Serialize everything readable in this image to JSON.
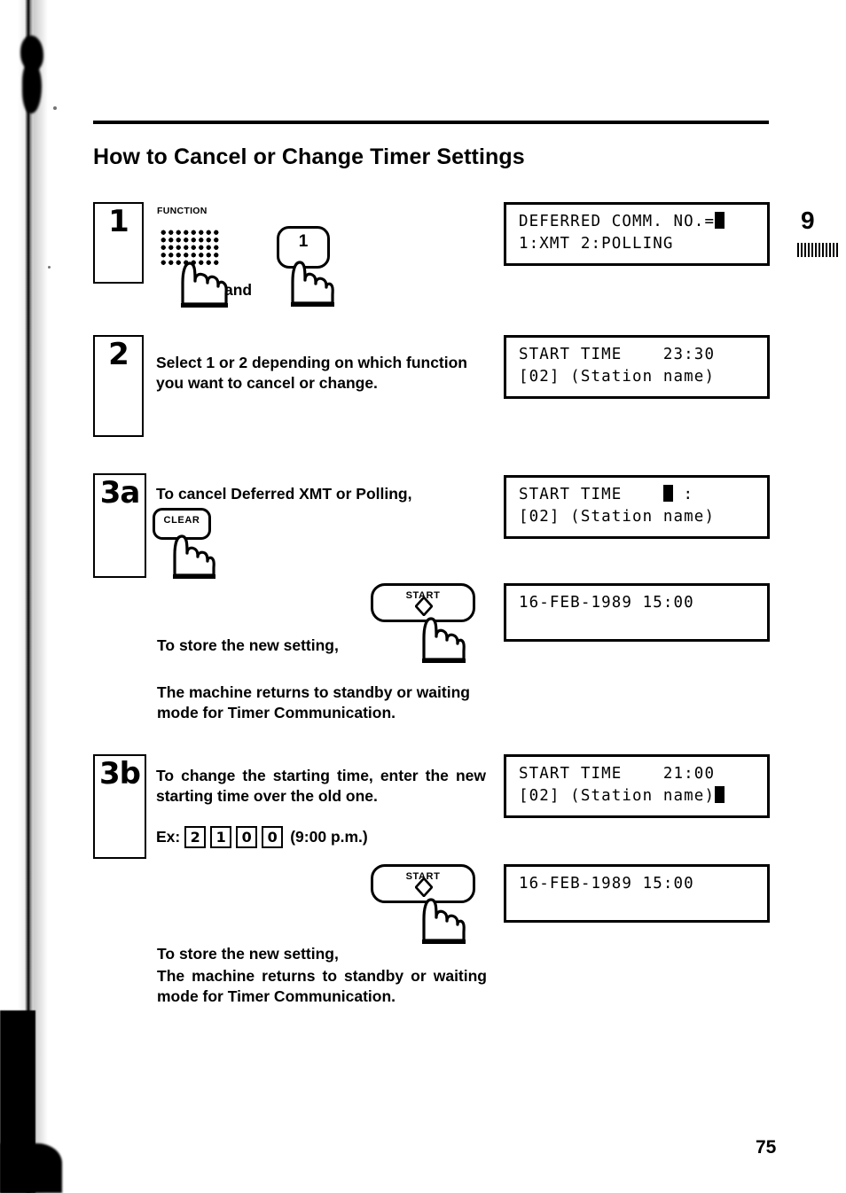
{
  "page": {
    "title": "How to Cancel or Change Timer Settings",
    "chapter_marker": "9",
    "folio": "75"
  },
  "steps": [
    {
      "number": "1",
      "keys": {
        "function_label": "FUNCTION",
        "function_icon": "dot-matrix-keypad",
        "conjunction": "and",
        "number_key_label": "1"
      },
      "display": {
        "line1_text": "DEFERRED COMM. NO.=",
        "line1_cursor": true,
        "line2_text": "1:XMT 2:POLLING",
        "line2_cursor": false
      }
    },
    {
      "number": "2",
      "instruction": "Select 1 or 2 depending on which function you want to cancel or change.",
      "display": {
        "line1_text": "START TIME    23:30",
        "line1_cursor": false,
        "line2_text": "[02] (Station name)",
        "line2_cursor": false
      }
    },
    {
      "number": "3a",
      "instruction": "To cancel Deferred XMT or Polling,",
      "key_label": "CLEAR",
      "display": {
        "line1_text": "START TIME    ",
        "line1_cursor": true,
        "line1_suffix": " :",
        "line2_text": "[02] (Station name)",
        "line2_cursor": false
      },
      "store_key_label": "START",
      "store_instruction": "To store the new setting,",
      "store_display": {
        "line1_text": "16-FEB-1989 15:00"
      },
      "result_text": "The machine returns to standby or waiting mode for Timer Communication."
    },
    {
      "number": "3b",
      "instruction": "To change the starting time, enter the new starting time over the old one.",
      "example_lead": "Ex:",
      "example_digits": [
        "2",
        "1",
        "0",
        "0"
      ],
      "example_tail": "(9:00 p.m.)",
      "display": {
        "line1_text": "START TIME    21:00",
        "line1_cursor": false,
        "line2_text": "[02] (Station name)",
        "line2_cursor": true
      },
      "store_key_label": "START",
      "store_instruction": "To store the new setting,",
      "store_display": {
        "line1_text": "16-FEB-1989 15:00"
      },
      "result_text": "The machine returns to standby or waiting mode for Timer Communication."
    }
  ]
}
